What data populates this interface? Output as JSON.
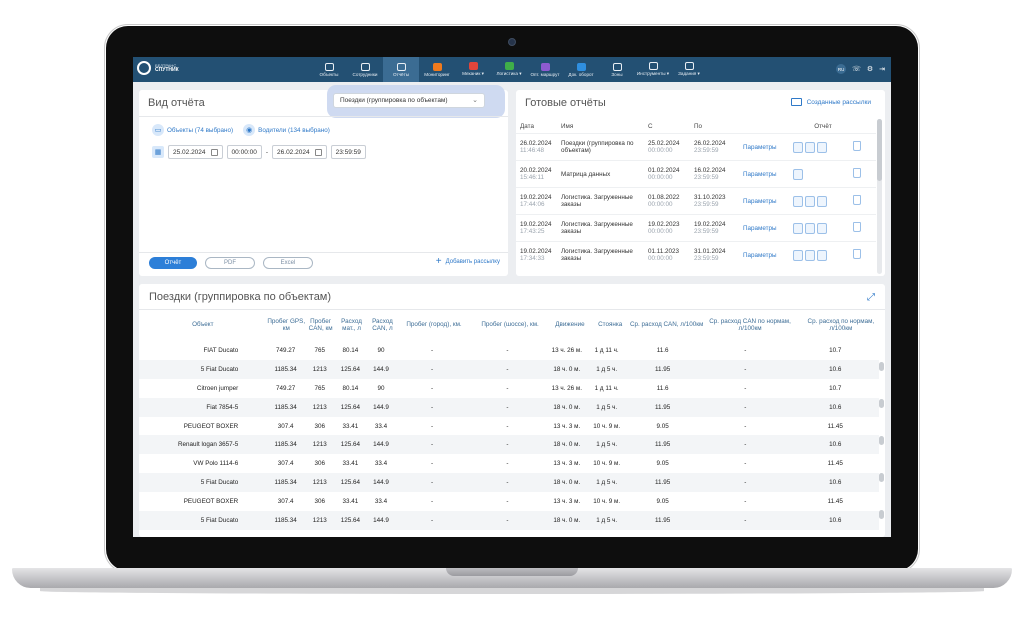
{
  "app": {
    "logo_small": "БЕЛТРАНС",
    "logo_main": "СПУТНИК"
  },
  "nav": [
    {
      "label": "Объекты",
      "icon": "truck-icon"
    },
    {
      "label": "Сотрудники",
      "icon": "people-icon"
    },
    {
      "label": "Отчёты",
      "icon": "report-icon",
      "active": true
    },
    {
      "label": "Мониторинг",
      "icon": "monitor-icon"
    },
    {
      "label": "Механик ▾",
      "icon": "mechanic-icon"
    },
    {
      "label": "Логистика ▾",
      "icon": "logistics-icon"
    },
    {
      "label": "Опт. маршрут",
      "icon": "route-icon"
    },
    {
      "label": "Док. оборот",
      "icon": "document-icon"
    },
    {
      "label": "Зоны",
      "icon": "zones-icon"
    },
    {
      "label": "Инструменты ▾",
      "icon": "tools-icon"
    },
    {
      "label": "Задания ▾",
      "icon": "tasks-icon"
    }
  ],
  "top_right": {
    "lang": "RU",
    "phone": "☏",
    "settings": "⚙",
    "logout": "⇥"
  },
  "report_view": {
    "title": "Вид отчёта",
    "selected": "Поездки (группировка по объектам)",
    "objects": "Объекты (74 выбрано)",
    "drivers": "Водители (134 выбрано)",
    "date_from": "25.02.2024",
    "time_from": "00:00:00",
    "date_to": "26.02.2024",
    "time_to": "23:59:59",
    "dash": "-",
    "btn_report": "Отчёт",
    "btn_pdf": "PDF",
    "btn_excel": "Excel",
    "add_mailing": "Добавить рассылку"
  },
  "ready_reports": {
    "title": "Готовые отчёты",
    "created_mailings": "Созданные рассылки",
    "headers": {
      "date": "Дата",
      "name": "Имя",
      "from": "С",
      "to": "По",
      "report": "Отчёт"
    },
    "params_label": "Параметры",
    "rows": [
      {
        "date": "26.02.2024",
        "time": "11:46:48",
        "name": "Поездки (группировка по объектам)",
        "from": "25.02.2024",
        "from_t": "00:00:00",
        "to": "26.02.2024",
        "to_t": "23:59:59",
        "files": 3
      },
      {
        "date": "20.02.2024",
        "time": "15:46:11",
        "name": "Матрица данных",
        "from": "01.02.2024",
        "from_t": "00:00:00",
        "to": "16.02.2024",
        "to_t": "23:59:59",
        "files": 1
      },
      {
        "date": "19.02.2024",
        "time": "17:44:06",
        "name": "Логистика. Загруженные заказы",
        "from": "01.08.2022",
        "from_t": "00:00:00",
        "to": "31.10.2023",
        "to_t": "23:59:59",
        "files": 3
      },
      {
        "date": "19.02.2024",
        "time": "17:43:25",
        "name": "Логистика. Загруженные заказы",
        "from": "19.02.2023",
        "from_t": "00:00:00",
        "to": "19.02.2024",
        "to_t": "23:59:59",
        "files": 3
      },
      {
        "date": "19.02.2024",
        "time": "17:34:33",
        "name": "Логистика. Загруженные заказы",
        "from": "01.11.2023",
        "from_t": "00:00:00",
        "to": "31.01.2024",
        "to_t": "23:59:59",
        "files": 3
      }
    ]
  },
  "trips": {
    "title": "Поездки (группировка по объектам)",
    "headers": [
      "Объект",
      "Пробег GPS, км",
      "Пробег CAN, км",
      "Расход мат., л",
      "Расход CAN, л",
      "Пробег (город), км.",
      "Пробег (шоссе), км.",
      "Движение",
      "Стоянка",
      "Ср. расход CAN, л/100км",
      "Ср. расход CAN по нормам, л/100км",
      "Ср. расход по нормам, л/100км"
    ],
    "rows": [
      [
        "FIAT Ducato",
        "749.27",
        "765",
        "80.14",
        "90",
        "-",
        "-",
        "13 ч. 26 м.",
        "1 д 11 ч.",
        "11.6",
        "-",
        "10.7"
      ],
      [
        "5 Fiat Ducato",
        "1185.34",
        "1213",
        "125.64",
        "144.9",
        "-",
        "-",
        "18 ч. 0 м.",
        "1 д 5 ч.",
        "11.95",
        "-",
        "10.6"
      ],
      [
        "Citroen jumper",
        "749.27",
        "765",
        "80.14",
        "90",
        "-",
        "-",
        "13 ч. 26 м.",
        "1 д 11 ч.",
        "11.6",
        "-",
        "10.7"
      ],
      [
        "Fiat 7854-5",
        "1185.34",
        "1213",
        "125.64",
        "144.9",
        "-",
        "-",
        "18 ч. 0 м.",
        "1 д 5 ч.",
        "11.95",
        "-",
        "10.6"
      ],
      [
        "PEUGEOT BOXER",
        "307.4",
        "306",
        "33.41",
        "33.4",
        "-",
        "-",
        "13 ч. 3 м.",
        "10 ч. 9 м.",
        "9.05",
        "-",
        "11.45"
      ],
      [
        "Renault logan 3657-5",
        "1185.34",
        "1213",
        "125.64",
        "144.9",
        "-",
        "-",
        "18 ч. 0 м.",
        "1 д 5 ч.",
        "11.95",
        "-",
        "10.6"
      ],
      [
        "VW Polo 1114-6",
        "307.4",
        "306",
        "33.41",
        "33.4",
        "-",
        "-",
        "13 ч. 3 м.",
        "10 ч. 9 м.",
        "9.05",
        "-",
        "11.45"
      ],
      [
        "5 Fiat Ducato",
        "1185.34",
        "1213",
        "125.64",
        "144.9",
        "-",
        "-",
        "18 ч. 0 м.",
        "1 д 5 ч.",
        "11.95",
        "-",
        "10.6"
      ],
      [
        "PEUGEOT BOXER",
        "307.4",
        "306",
        "33.41",
        "33.4",
        "-",
        "-",
        "13 ч. 3 м.",
        "10 ч. 9 м.",
        "9.05",
        "-",
        "11.45"
      ],
      [
        "5 Fiat Ducato",
        "1185.34",
        "1213",
        "125.64",
        "144.9",
        "-",
        "-",
        "18 ч. 0 м.",
        "1 д 5 ч.",
        "11.95",
        "-",
        "10.6"
      ]
    ]
  }
}
